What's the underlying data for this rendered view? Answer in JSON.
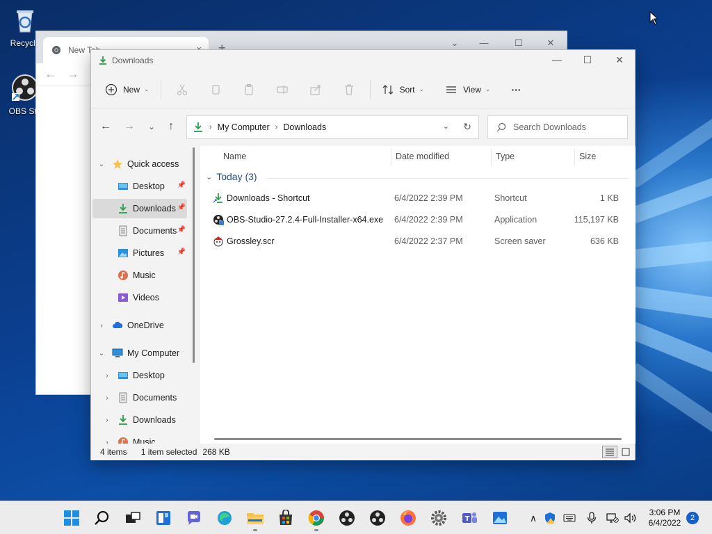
{
  "desktop": {
    "icons": [
      {
        "label": "Recycle"
      },
      {
        "label": "OBS Stu"
      }
    ]
  },
  "chrome": {
    "tab_title": "New Tab",
    "tab_close": "×",
    "new_tab": "+",
    "back": "←",
    "forward": "→"
  },
  "explorer": {
    "title": "Downloads",
    "window_controls": {
      "minimize": "—",
      "maximize": "☐",
      "close": "✕"
    },
    "commands": {
      "new_label": "New",
      "sort_label": "Sort",
      "view_label": "View",
      "more_label": "···"
    },
    "breadcrumb": [
      "My Computer",
      "Downloads"
    ],
    "search_placeholder": "Search Downloads",
    "nav": {
      "quick_access": "Quick access",
      "quick_items": [
        {
          "label": "Desktop",
          "pinned": true
        },
        {
          "label": "Downloads",
          "pinned": true,
          "selected": true
        },
        {
          "label": "Documents",
          "pinned": true
        },
        {
          "label": "Pictures",
          "pinned": true
        },
        {
          "label": "Music",
          "pinned": false
        },
        {
          "label": "Videos",
          "pinned": false
        }
      ],
      "onedrive": "OneDrive",
      "my_computer": "My Computer",
      "computer_items": [
        {
          "label": "Desktop"
        },
        {
          "label": "Documents"
        },
        {
          "label": "Downloads"
        },
        {
          "label": "Music"
        }
      ]
    },
    "columns": {
      "name": "Name",
      "date": "Date modified",
      "type": "Type",
      "size": "Size"
    },
    "group_label": "Today (3)",
    "files": [
      {
        "name": "Downloads - Shortcut",
        "date": "6/4/2022 2:39 PM",
        "type": "Shortcut",
        "size": "1 KB",
        "icon": "shortcut-download-icon"
      },
      {
        "name": "OBS-Studio-27.2.4-Full-Installer-x64.exe",
        "date": "6/4/2022 2:39 PM",
        "type": "Application",
        "size": "115,197 KB",
        "icon": "obs-installer-icon"
      },
      {
        "name": "Grossley.scr",
        "date": "6/4/2022 2:37 PM",
        "type": "Screen saver",
        "size": "636 KB",
        "icon": "screensaver-icon"
      }
    ],
    "status": {
      "item_count": "4 items",
      "selection": "1 item selected",
      "selection_size": "268 KB"
    }
  },
  "taskbar": {
    "apps": [
      "start-icon",
      "search-icon",
      "task-view-icon",
      "widgets-icon",
      "chat-icon",
      "edge-icon",
      "file-explorer-icon",
      "store-icon",
      "chrome-icon",
      "obs-icon",
      "obs-icon-2",
      "firefox-icon",
      "settings-icon",
      "teams-icon",
      "photos-icon"
    ],
    "clock_time": "3:06 PM",
    "clock_date": "6/4/2022",
    "notification_count": "2"
  },
  "colors": {
    "accent": "#1460c8",
    "download_green": "#2a9d4a",
    "folder_yellow": "#f2c14e",
    "selected_bg": "#dadada"
  }
}
